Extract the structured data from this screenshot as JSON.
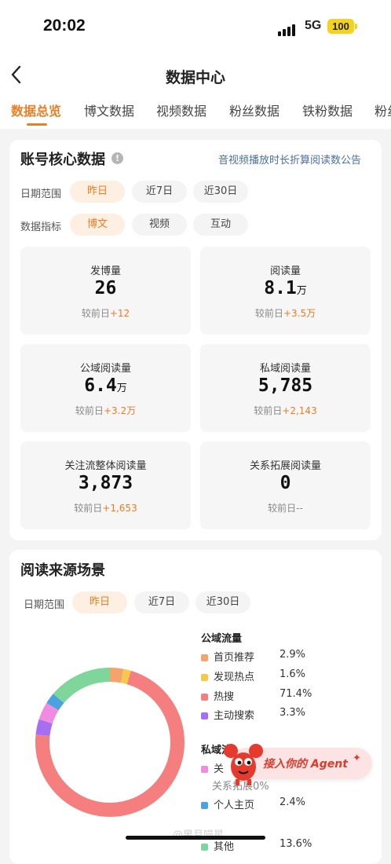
{
  "status_bar": {
    "time": "20:02",
    "network": "5G",
    "battery": "100"
  },
  "nav": {
    "title": "数据中心"
  },
  "tabs": [
    "数据总览",
    "博文数据",
    "视频数据",
    "粉丝数据",
    "铁粉数据",
    "粉丝"
  ],
  "core": {
    "title": "账号核心数据",
    "notice": "音视频播放时长折算阅读数公告",
    "date_label": "日期范围",
    "date_options": [
      "昨日",
      "近7日",
      "近30日"
    ],
    "metric_label": "数据指标",
    "metric_options": [
      "博文",
      "视频",
      "互动"
    ],
    "compare_label": "较前日",
    "metrics": [
      {
        "label": "发博量",
        "value": "26",
        "unit": "",
        "delta": "+12"
      },
      {
        "label": "阅读量",
        "value": "8.1",
        "unit": "万",
        "delta": "+3.5万"
      },
      {
        "label": "公域阅读量",
        "value": "6.4",
        "unit": "万",
        "delta": "+3.2万"
      },
      {
        "label": "私域阅读量",
        "value": "5,785",
        "unit": "",
        "delta": "+2,143"
      },
      {
        "label": "关注流整体阅读量",
        "value": "3,873",
        "unit": "",
        "delta": "+1,653"
      },
      {
        "label": "关系拓展阅读量",
        "value": "0",
        "unit": "",
        "delta": "--"
      }
    ]
  },
  "source": {
    "title": "阅读来源场景",
    "date_label": "日期范围",
    "date_options": [
      "昨日",
      "近7日",
      "近30日"
    ],
    "public_label": "公域流量",
    "public_items": [
      {
        "name": "首页推荐",
        "pct": "2.9%",
        "color": "#f4a46a"
      },
      {
        "name": "发现热点",
        "pct": "1.6%",
        "color": "#f7c94a"
      },
      {
        "name": "热搜",
        "pct": "71.4%",
        "color": "#f57f7f"
      },
      {
        "name": "主动搜索",
        "pct": "3.3%",
        "color": "#a66ef0"
      }
    ],
    "private_label": "私域流",
    "private_partial_item": "关",
    "private_partial_note": "关系拓展0%",
    "private_items": [
      {
        "name": "个人主页",
        "pct": "2.4%",
        "color": "#4aa3e0"
      },
      {
        "name": "其他",
        "pct": "13.6%",
        "color": "#7fd69a"
      }
    ],
    "private_partial_color": "#f18be0"
  },
  "chart_data": {
    "type": "pie",
    "title": "",
    "series": [
      {
        "name": "首页推荐",
        "value": 2.9,
        "color": "#f4a46a"
      },
      {
        "name": "发现热点",
        "value": 1.6,
        "color": "#f7c94a"
      },
      {
        "name": "热搜",
        "value": 71.4,
        "color": "#f57f7f"
      },
      {
        "name": "主动搜索",
        "value": 3.3,
        "color": "#a66ef0"
      },
      {
        "name": "关",
        "value": 3.8,
        "color": "#f18be0"
      },
      {
        "name": "个人主页",
        "value": 2.4,
        "color": "#4aa3e0"
      },
      {
        "name": "其他",
        "value": 13.6,
        "color": "#7fd69a"
      }
    ]
  },
  "agent_button": {
    "label": "接入你的 Agent"
  },
  "watermark": "@果月喵星"
}
